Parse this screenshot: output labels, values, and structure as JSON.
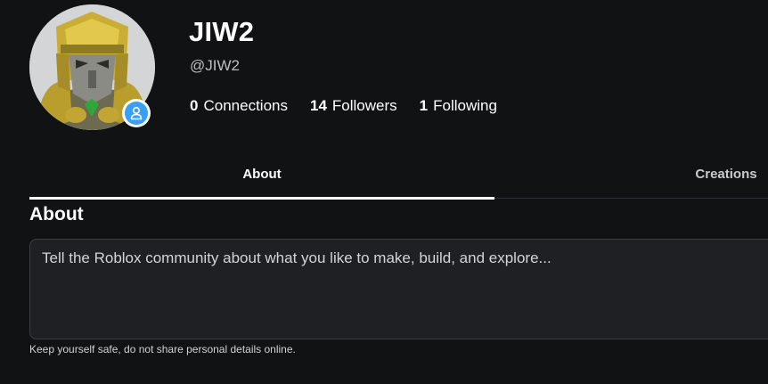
{
  "profile": {
    "display_name": "JIW2",
    "username": "@JIW2",
    "presence_color": "#3aa0f5"
  },
  "stats": [
    {
      "count": "0",
      "label": "Connections"
    },
    {
      "count": "14",
      "label": "Followers"
    },
    {
      "count": "1",
      "label": "Following"
    }
  ],
  "tabs": [
    {
      "label": "About",
      "active": true
    },
    {
      "label": "Creations",
      "active": false
    }
  ],
  "about": {
    "heading": "About",
    "placeholder": "Tell the Roblox community about what you like to make, build, and explore...",
    "safety_note": "Keep yourself safe, do not share personal details online."
  },
  "icons": {
    "avatar": "avatar-image",
    "presence": "user-status-icon"
  }
}
